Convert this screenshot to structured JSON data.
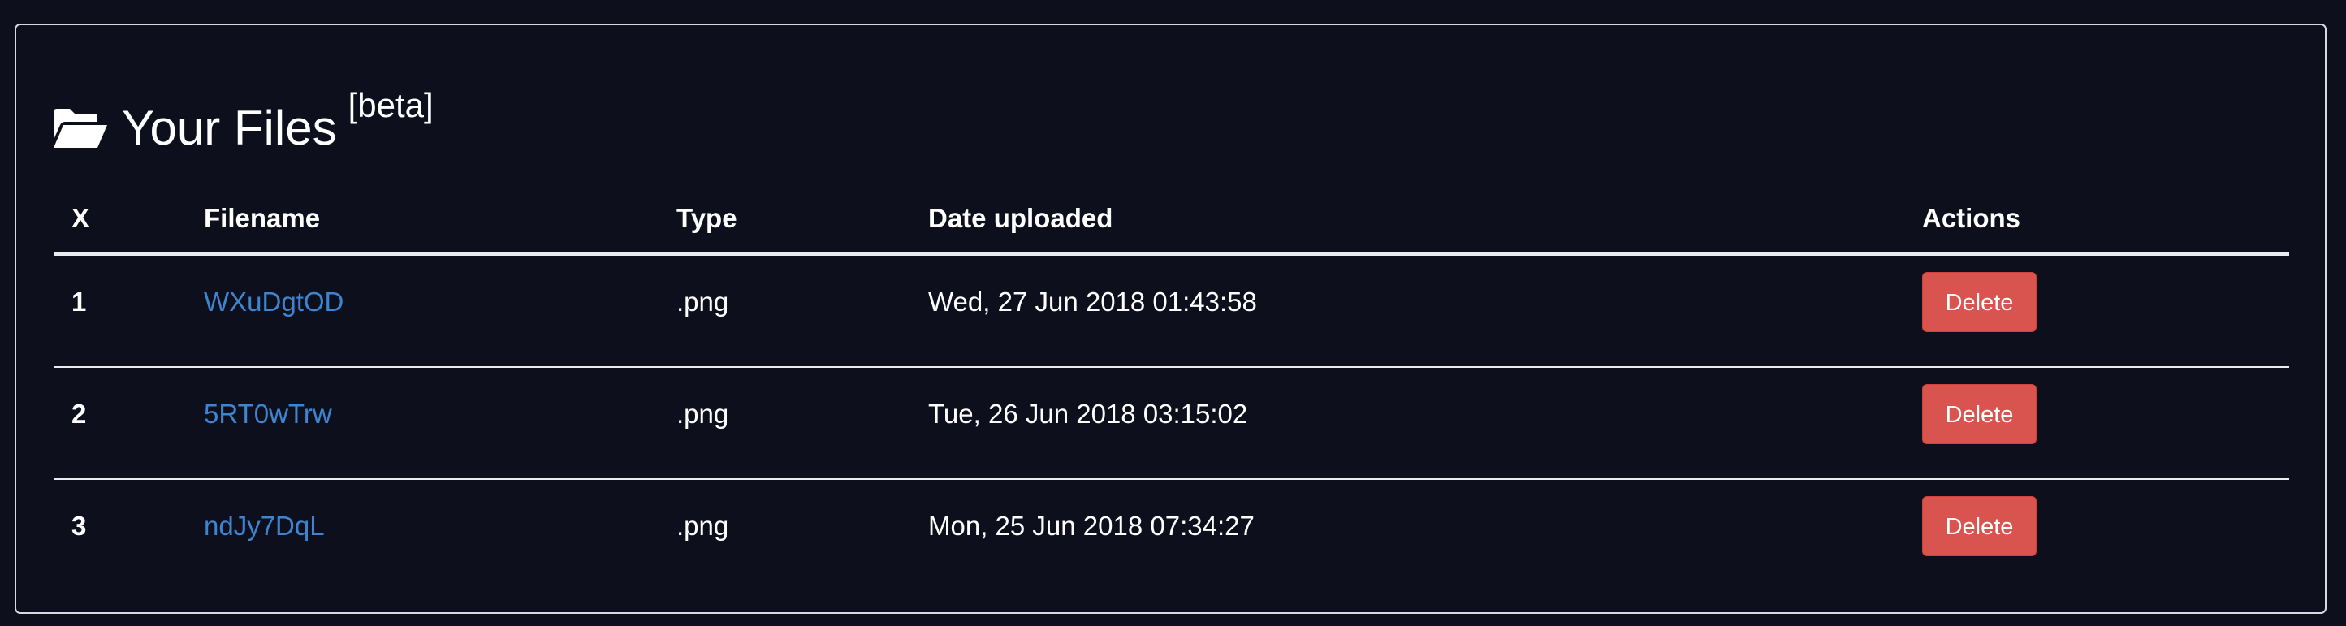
{
  "header": {
    "title": "Your Files",
    "badge": "[beta]",
    "icon": "folder-open-icon"
  },
  "table": {
    "columns": [
      "X",
      "Filename",
      "Type",
      "Date uploaded",
      "Actions"
    ],
    "rows": [
      {
        "index": "1",
        "filename": "WXuDgtOD",
        "type": ".png",
        "date": "Wed, 27 Jun 2018 01:43:58",
        "action": "Delete"
      },
      {
        "index": "2",
        "filename": "5RT0wTrw",
        "type": ".png",
        "date": "Tue, 26 Jun 2018 03:15:02",
        "action": "Delete"
      },
      {
        "index": "3",
        "filename": "ndJy7DqL",
        "type": ".png",
        "date": "Mon, 25 Jun 2018 07:34:27",
        "action": "Delete"
      }
    ]
  },
  "colors": {
    "background": "#0d101c",
    "link": "#3f84d0",
    "danger": "#d9534f",
    "text": "#ffffff"
  }
}
